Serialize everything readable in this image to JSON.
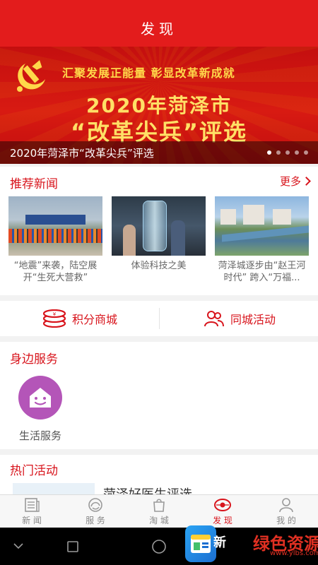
{
  "header": {
    "title": "发现"
  },
  "banner": {
    "slogan": "汇聚发展正能量 彰显改革新成就",
    "headline_year": "2020年菏泽市",
    "headline_big": "“改革尖兵”评选",
    "caption": "2020年菏泽市“改革尖兵”评选",
    "dots": 5,
    "active_dot": 0
  },
  "recommended_news": {
    "title": "推荐新闻",
    "more_label": "更多",
    "items": [
      {
        "caption": "“地震”来袭，陆空展开“生死大营救”"
      },
      {
        "caption": "体验科技之美"
      },
      {
        "caption": "菏泽城逐步由“赵王河时代” 跨入“万福..."
      }
    ]
  },
  "quick_links": [
    {
      "label": "积分商城",
      "icon": "coins-icon"
    },
    {
      "label": "同城活动",
      "icon": "people-icon"
    }
  ],
  "nearby_services": {
    "title": "身边服务",
    "items": [
      {
        "label": "生活服务",
        "icon": "smiling-house-icon",
        "color": "#b455b8"
      }
    ]
  },
  "hot_activities": {
    "title": "热门活动",
    "first_item_text": "菏泽好医生评选"
  },
  "tabbar": {
    "active": 3,
    "tabs": [
      {
        "label": "新 闻",
        "icon": "newspaper-icon"
      },
      {
        "label": "服 务",
        "icon": "service-icon"
      },
      {
        "label": "淘 城",
        "icon": "shopping-bag-icon"
      },
      {
        "label": "发 现",
        "icon": "eye-icon"
      },
      {
        "label": "我 的",
        "icon": "user-icon"
      }
    ]
  },
  "watermark": {
    "text_a": "新",
    "text_b": "绿色资源网",
    "text_c": "www.ylbs.com"
  },
  "colors": {
    "brand_red": "#e31c1c",
    "accent_red": "#d8141c",
    "service_purple": "#b455b8"
  }
}
